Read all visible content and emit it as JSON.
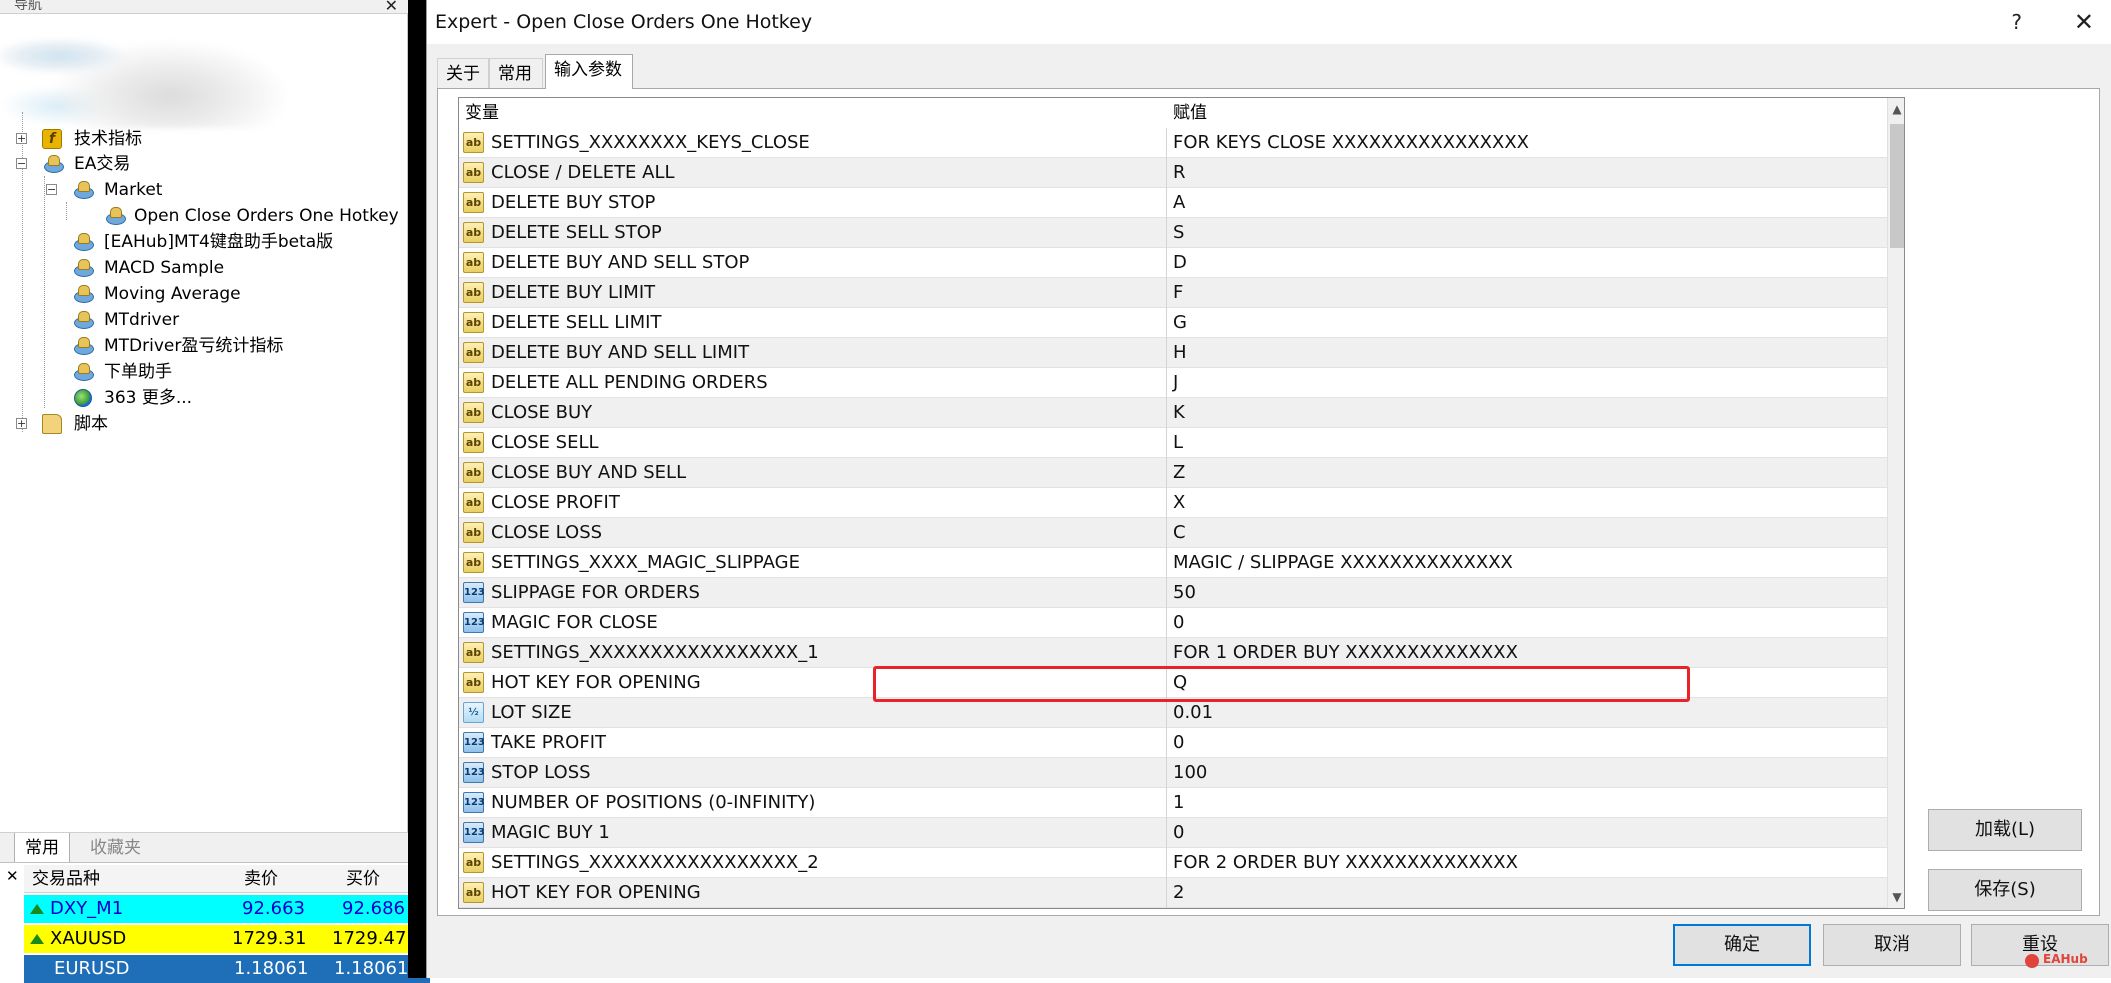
{
  "navigator": {
    "title": "导航",
    "tree": [
      {
        "label": "技术指标",
        "icon": "indicator-icon"
      },
      {
        "label": "EA交易",
        "icon": "expert-icon"
      },
      {
        "label": "Market",
        "icon": "market-folder-icon"
      },
      {
        "label": "Open Close Orders One Hotkey",
        "icon": "expert-icon"
      },
      {
        "label": "[EAHub]MT4键盘助手beta版",
        "icon": "expert-icon"
      },
      {
        "label": "MACD Sample",
        "icon": "expert-icon"
      },
      {
        "label": "Moving Average",
        "icon": "expert-icon"
      },
      {
        "label": "MTdriver",
        "icon": "expert-icon"
      },
      {
        "label": "MTDriver盈亏统计指标",
        "icon": "expert-icon"
      },
      {
        "label": "下单助手",
        "icon": "expert-icon"
      },
      {
        "label": "363 更多...",
        "icon": "globe-icon"
      },
      {
        "label": "脚本",
        "icon": "script-icon"
      }
    ],
    "tabs": [
      "常用",
      "收藏夹"
    ]
  },
  "market_watch": {
    "headers": [
      "交易品种",
      "卖价",
      "买价"
    ],
    "rows": [
      {
        "symbol": "DXY_M1",
        "bid": "92.663",
        "ask": "92.686",
        "bg": "#00ffff",
        "color": "#0000cc"
      },
      {
        "symbol": "XAUUSD",
        "bid": "1729.31",
        "ask": "1729.47",
        "bg": "#ffff00",
        "color": "#000000"
      },
      {
        "symbol": "EURUSD",
        "bid": "1.18061",
        "ask": "1.18061",
        "bg": "#1f6fb8",
        "color": "#ffffff"
      }
    ]
  },
  "dialog": {
    "title": "Expert - Open Close Orders One Hotkey",
    "help": "?",
    "close": "✕",
    "tabs": [
      "关于",
      "常用",
      "输入参数"
    ],
    "grid": {
      "col_variable": "变量",
      "col_value": "赋值",
      "rows": [
        {
          "type": "ab",
          "var": "SETTINGS_XXXXXXXX_KEYS_CLOSE",
          "val": "FOR KEYS CLOSE XXXXXXXXXXXXXXXX"
        },
        {
          "type": "ab",
          "var": "CLOSE / DELETE ALL",
          "val": "R"
        },
        {
          "type": "ab",
          "var": "DELETE BUY STOP",
          "val": "A"
        },
        {
          "type": "ab",
          "var": "DELETE SELL STOP",
          "val": "S"
        },
        {
          "type": "ab",
          "var": "DELETE BUY AND SELL STOP",
          "val": "D"
        },
        {
          "type": "ab",
          "var": "DELETE BUY LIMIT",
          "val": "F"
        },
        {
          "type": "ab",
          "var": "DELETE SELL LIMIT",
          "val": "G"
        },
        {
          "type": "ab",
          "var": "DELETE BUY AND SELL LIMIT",
          "val": "H"
        },
        {
          "type": "ab",
          "var": "DELETE ALL PENDING ORDERS",
          "val": "J"
        },
        {
          "type": "ab",
          "var": "CLOSE BUY",
          "val": "K"
        },
        {
          "type": "ab",
          "var": "CLOSE SELL",
          "val": "L"
        },
        {
          "type": "ab",
          "var": "CLOSE BUY AND SELL",
          "val": "Z"
        },
        {
          "type": "ab",
          "var": "CLOSE PROFIT",
          "val": "X"
        },
        {
          "type": "ab",
          "var": "CLOSE LOSS",
          "val": "C"
        },
        {
          "type": "ab",
          "var": "SETTINGS_XXXX_MAGIC_SLIPPAGE",
          "val": "MAGIC / SLIPPAGE XXXXXXXXXXXXXX"
        },
        {
          "type": "123",
          "var": "SLIPPAGE FOR ORDERS",
          "val": "50"
        },
        {
          "type": "123",
          "var": "MAGIC FOR CLOSE",
          "val": "0"
        },
        {
          "type": "ab",
          "var": "SETTINGS_XXXXXXXXXXXXXXXXX_1",
          "val": "FOR 1 ORDER BUY  XXXXXXXXXXXXXX"
        },
        {
          "type": "ab",
          "var": "HOT KEY FOR OPENING",
          "val": "Q"
        },
        {
          "type": "half",
          "var": "LOT SIZE",
          "val": "0.01"
        },
        {
          "type": "123",
          "var": "TAKE PROFIT",
          "val": "0"
        },
        {
          "type": "123",
          "var": "STOP LOSS",
          "val": "100"
        },
        {
          "type": "123",
          "var": "NUMBER OF POSITIONS (0-INFINITY)",
          "val": "1"
        },
        {
          "type": "123",
          "var": "MAGIC BUY 1",
          "val": "0"
        },
        {
          "type": "ab",
          "var": "SETTINGS_XXXXXXXXXXXXXXXXX_2",
          "val": "FOR 2 ORDER BUY  XXXXXXXXXXXXXX"
        },
        {
          "type": "ab",
          "var": "HOT KEY FOR OPENING",
          "val": "2"
        }
      ]
    },
    "buttons": {
      "load": "加载(L)",
      "save": "保存(S)",
      "ok": "确定",
      "cancel": "取消",
      "reset": "重设"
    },
    "watermark": "EAHub"
  }
}
